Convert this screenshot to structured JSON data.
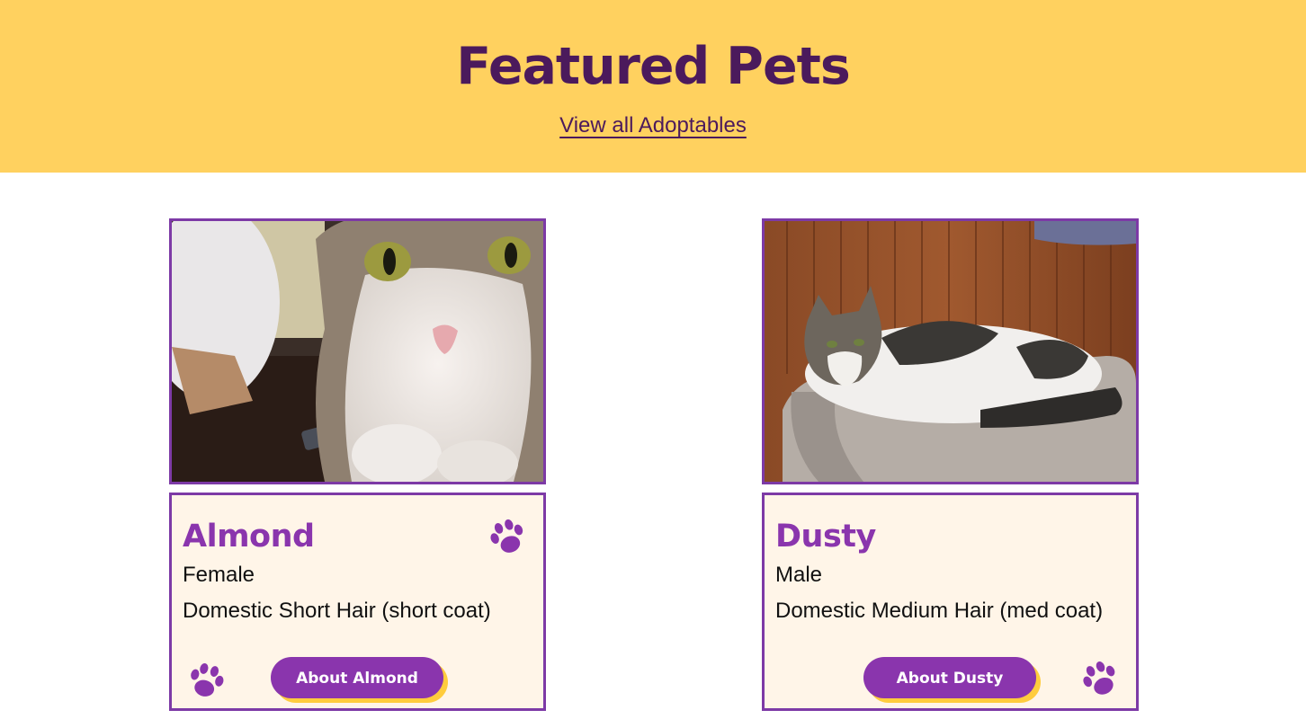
{
  "header": {
    "title": "Featured Pets",
    "view_all_link": "View all Adoptables"
  },
  "colors": {
    "banner": "#ffd15f",
    "title": "#4b1a5c",
    "accent_purple": "#8a35ad",
    "card_border": "#7d3aa6",
    "card_background": "#fff5e8",
    "button_shadow": "#ffcc3d"
  },
  "pets": [
    {
      "name": "Almond",
      "sex": "Female",
      "breed": "Domestic Short Hair (short coat)",
      "button_label": "About Almond",
      "photo_alt": "Almond",
      "icons": [
        "paw-icon",
        "paw-icon"
      ]
    },
    {
      "name": "Dusty",
      "sex": "Male",
      "breed": "Domestic Medium Hair (med coat)",
      "button_label": "About Dusty",
      "photo_alt": "Dusty",
      "icons": [
        "paw-icon"
      ]
    }
  ]
}
